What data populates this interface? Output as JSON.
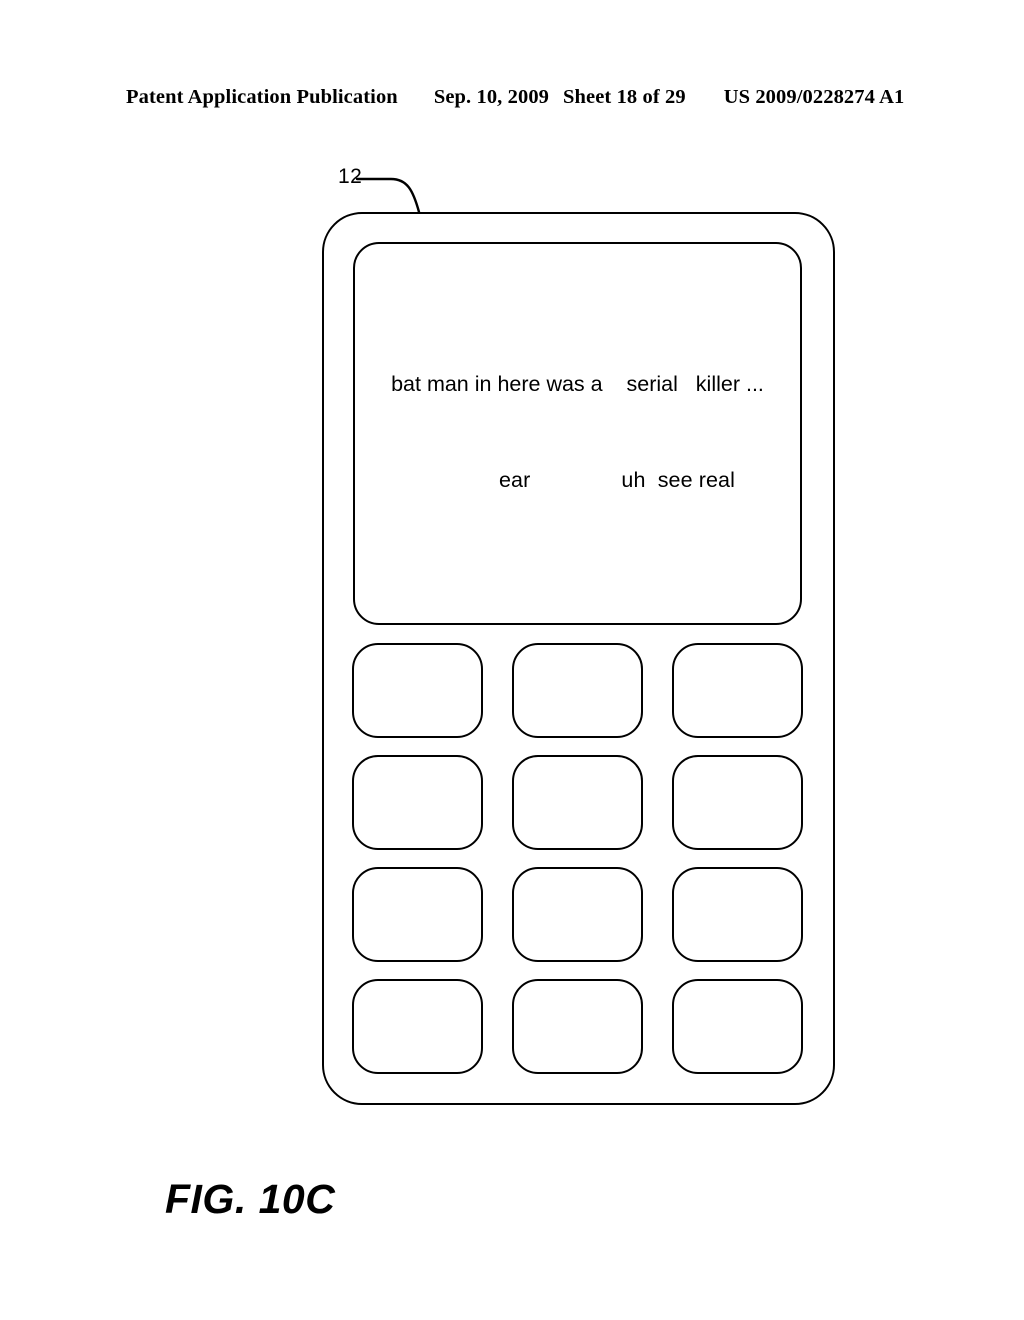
{
  "page": {
    "header": {
      "publication": "Patent Application Publication",
      "date": "Sep. 10, 2009",
      "sheet": "Sheet 18 of 29",
      "patent_number": "US 2009/0228274 A1"
    },
    "figure_caption": "FIG. 10C",
    "background_color": "#ffffff",
    "line_color": "#000000"
  },
  "figure": {
    "reference_numerals": [
      {
        "id": "12",
        "label": "12",
        "points_to": "mobile-device-body"
      }
    ],
    "device": {
      "name": "mobile-device",
      "screen": {
        "name": "display-screen",
        "lines": [
          "bat man in here was a    serial   killer ...",
          "             ear               uh  see real"
        ],
        "line_1": "bat man in here was a    serial   killer ...",
        "line_2": "             ear               uh  see real"
      },
      "keypad": {
        "rows": 4,
        "columns": 3,
        "keys": [
          {
            "label": ""
          },
          {
            "label": ""
          },
          {
            "label": ""
          },
          {
            "label": ""
          },
          {
            "label": ""
          },
          {
            "label": ""
          },
          {
            "label": ""
          },
          {
            "label": ""
          },
          {
            "label": ""
          },
          {
            "label": ""
          },
          {
            "label": ""
          },
          {
            "label": ""
          }
        ]
      }
    }
  }
}
